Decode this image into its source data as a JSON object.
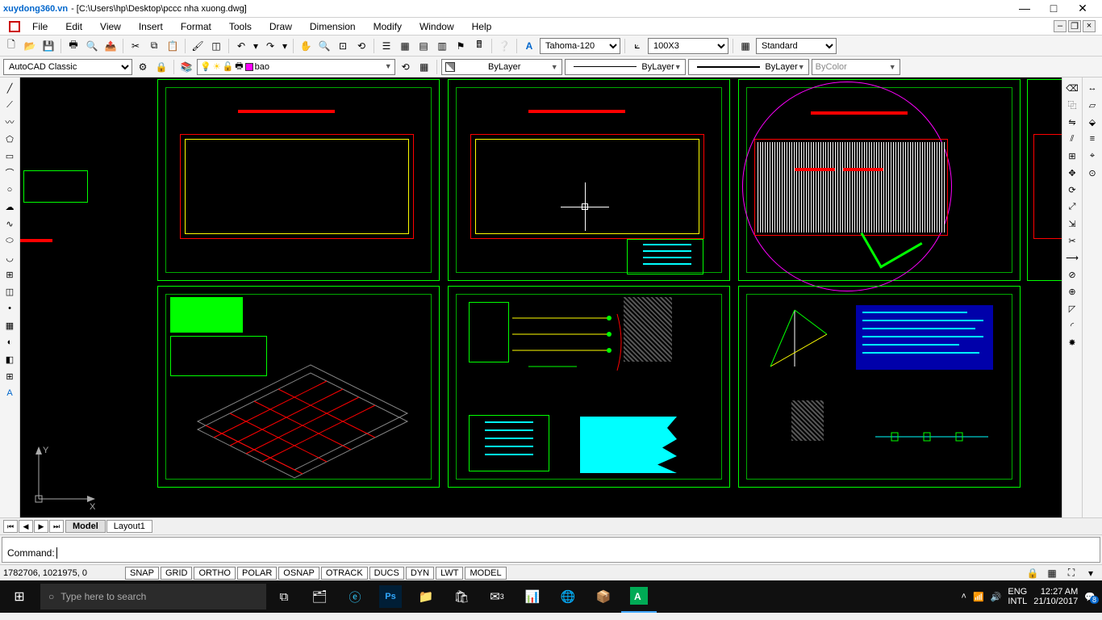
{
  "title": {
    "logo": "xuydong360.vn",
    "path": " - [C:\\Users\\hp\\Desktop\\pccc nha xuong.dwg]"
  },
  "menu": {
    "file": "File",
    "edit": "Edit",
    "view": "View",
    "insert": "Insert",
    "format": "Format",
    "tools": "Tools",
    "draw": "Draw",
    "dimension": "Dimension",
    "modify": "Modify",
    "window": "Window",
    "help": "Help"
  },
  "workspace": {
    "name": "AutoCAD Classic"
  },
  "layer": {
    "current": "bao"
  },
  "textstyle": {
    "current": "Tahoma-120"
  },
  "dimstyle": {
    "current": "100X3"
  },
  "tablestyle": {
    "current": "Standard"
  },
  "props": {
    "color": "ByLayer",
    "ltype": "ByLayer",
    "lweight": "ByLayer",
    "plot": "ByColor"
  },
  "tabs": {
    "model": "Model",
    "layout1": "Layout1"
  },
  "cmd": {
    "prompt": "Command: "
  },
  "status": {
    "coords": "1782706, 1021975, 0",
    "snap": "SNAP",
    "grid": "GRID",
    "ortho": "ORTHO",
    "polar": "POLAR",
    "osnap": "OSNAP",
    "otrack": "OTRACK",
    "ducs": "DUCS",
    "dyn": "DYN",
    "lwt": "LWT",
    "model": "MODEL"
  },
  "taskbar": {
    "search_placeholder": "Type here to search",
    "lang": "ENG",
    "kbd": "INTL",
    "time": "12:27 AM",
    "date": "21/10/2017",
    "notif": "8"
  }
}
